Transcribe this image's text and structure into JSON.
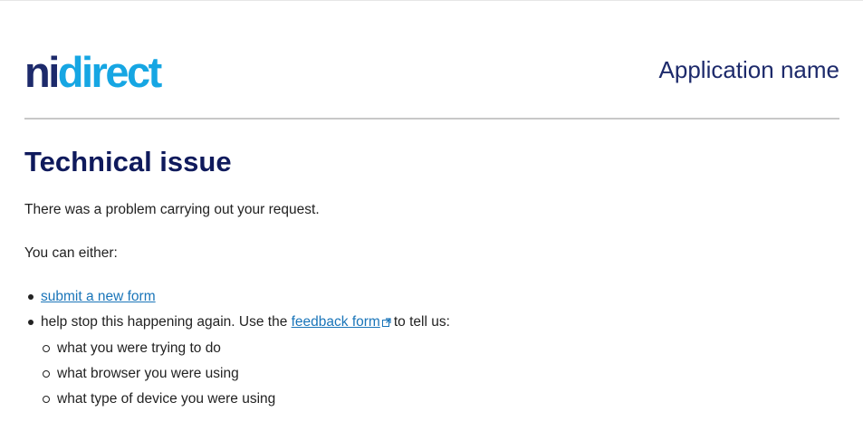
{
  "header": {
    "logo_part1": "ni",
    "logo_part2": "direct",
    "app_name": "Application name"
  },
  "main": {
    "title": "Technical issue",
    "intro": "There was a problem carrying out your request.",
    "either": "You can either:",
    "items": [
      {
        "link_text": "submit a new form"
      },
      {
        "text_before": "help stop this happening again. Use the ",
        "link_text": "feedback form",
        "link_icon": "external-link-icon",
        "text_after": "to tell us:",
        "subitems": [
          "what you were trying to do",
          "what browser you were using",
          "what type of device you were using"
        ]
      }
    ]
  },
  "colors": {
    "logo_ni": "#1d2a6b",
    "logo_direct": "#16a6e3",
    "heading": "#0f1a5c",
    "link": "#1a75b9",
    "divider": "#c8c8c8"
  }
}
